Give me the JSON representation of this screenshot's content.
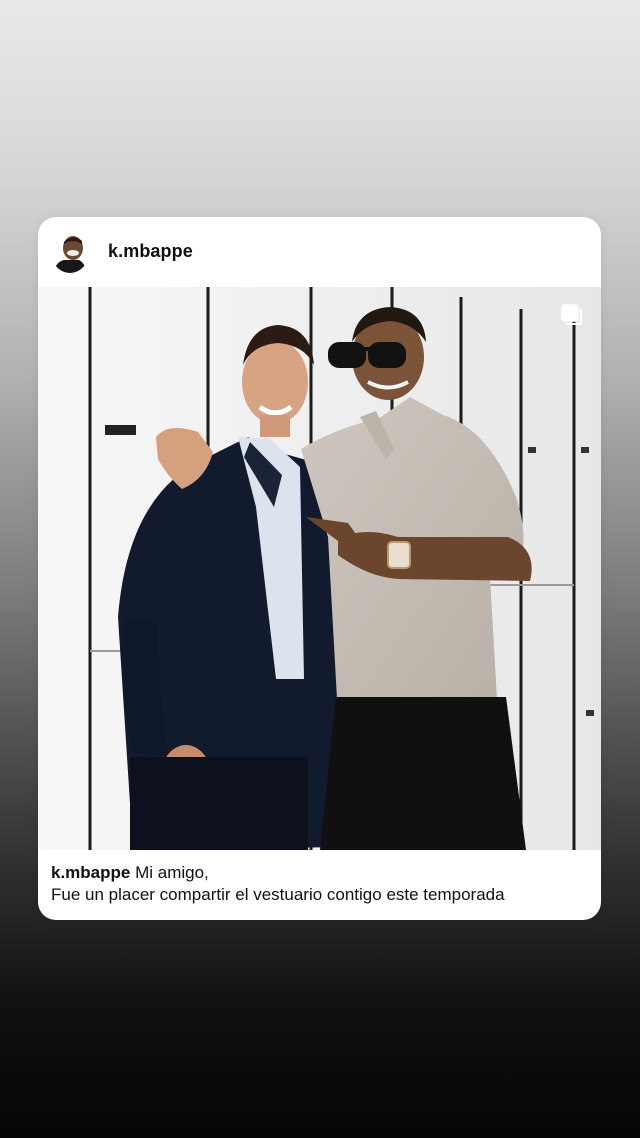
{
  "post": {
    "username": "k.mbappe",
    "caption_user": "k.mbappe",
    "caption_first": "Mi amigo,",
    "caption_second": "Fue un placer compartir el vestuario contigo este temporada",
    "photo_description": "two men posing in front of white lockers",
    "icons": {
      "avatar": "profile-avatar",
      "multi_post": "multiple-photos-icon"
    }
  },
  "colors": {
    "card_bg": "#ffffff",
    "text": "#111111",
    "bg_top": "#e9e9e9",
    "bg_bottom": "#050505"
  }
}
